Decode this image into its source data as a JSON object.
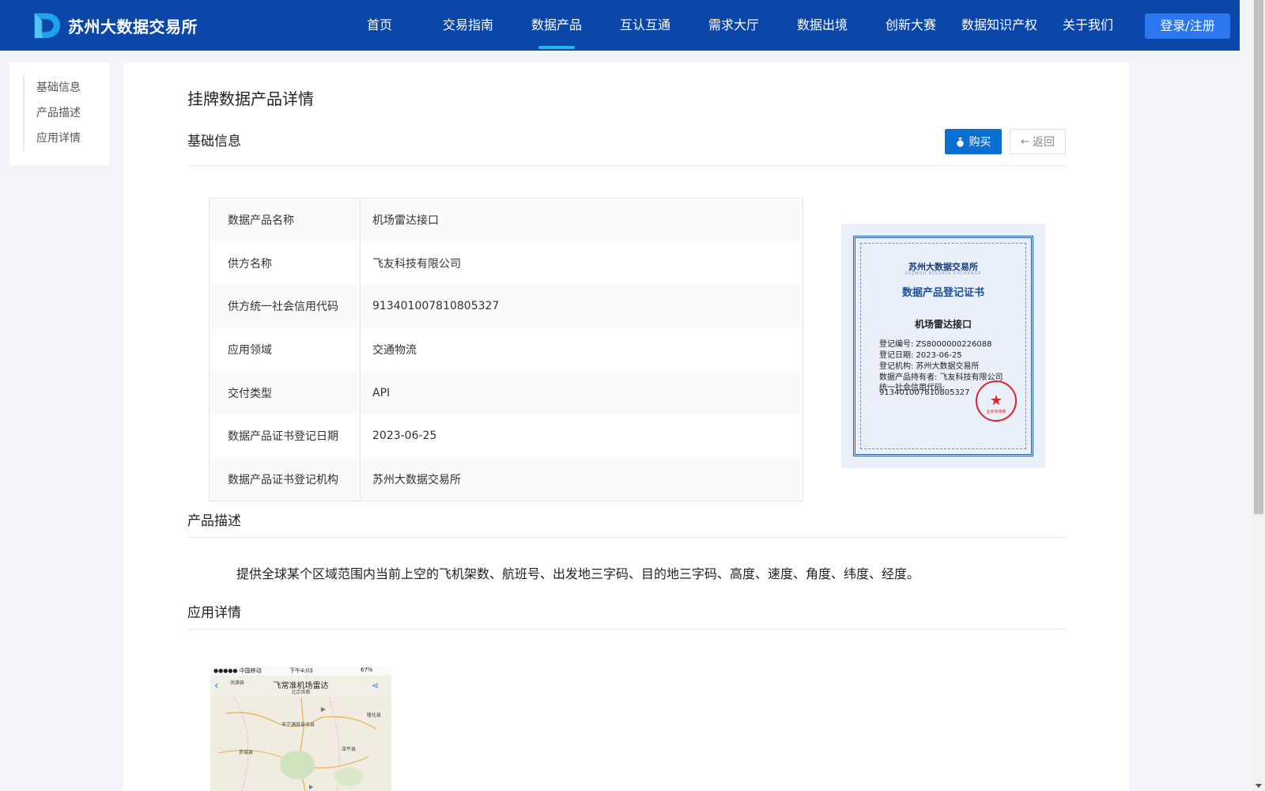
{
  "header": {
    "logo_text": "苏州大数据交易所",
    "nav": [
      {
        "label": "首页",
        "active": false
      },
      {
        "label": "交易指南",
        "active": false
      },
      {
        "label": "数据产品",
        "active": true
      },
      {
        "label": "互认互通",
        "active": false
      },
      {
        "label": "需求大厅",
        "active": false
      },
      {
        "label": "数据出境",
        "active": false
      },
      {
        "label": "创新大赛",
        "active": false
      },
      {
        "label": "数据知识产权",
        "active": false
      },
      {
        "label": "关于我们",
        "active": false
      }
    ],
    "login_label": "登录/注册"
  },
  "side_anchor": {
    "items": [
      "基础信息",
      "产品描述",
      "应用详情"
    ]
  },
  "main": {
    "page_title": "挂牌数据产品详情",
    "basic_section_title": "基础信息",
    "buy_label": "购买",
    "back_label": "返回",
    "info_rows": [
      {
        "key": "数据产品名称",
        "value": "机场雷达接口"
      },
      {
        "key": "供方名称",
        "value": "飞友科技有限公司"
      },
      {
        "key": "供方统一社会信用代码",
        "value": "913401007810805327"
      },
      {
        "key": "应用领域",
        "value": "交通物流"
      },
      {
        "key": "交付类型",
        "value": "API"
      },
      {
        "key": "数据产品证书登记日期",
        "value": "2023-06-25"
      },
      {
        "key": "数据产品证书登记机构",
        "value": "苏州大数据交易所"
      }
    ],
    "certificate": {
      "org_name": "苏州大数据交易所",
      "org_name_en": "SUZHOU BIGDATA EXCHANGE",
      "title": "数据产品登记证书",
      "product": "机场雷达接口",
      "lines": [
        "登记编号: ZS8000000226088",
        "登记日期: 2023-06-25",
        "登记机构: 苏州大数据交易所",
        "数据产品持有者: 飞友科技有限公司",
        "统一社会信用代码:",
        "913401007810805327"
      ],
      "seal_text": "业务专用章"
    },
    "desc_section_title": "产品描述",
    "description": "提供全球某个区域范围内当前上空的飞机架数、航班号、出发地三字码、目的地三字码、高度、速度、角度、纬度、经度。",
    "app_section_title": "应用详情",
    "app_preview": {
      "carrier": "●●●●● 中国移动",
      "time": "下午4:03",
      "battery": "67%",
      "title": "飞常准机场雷达",
      "subtitle": "北京首都",
      "map_labels": [
        "沽源县",
        "隆化县",
        "丰宁满族自治县",
        "赤城县",
        "滦平县"
      ]
    }
  },
  "colors": {
    "header_bg": "#0b47a8",
    "active_indicator": "#1fb6e8",
    "login_btn": "#2a77ef",
    "buy_btn": "#0b6fd1"
  }
}
